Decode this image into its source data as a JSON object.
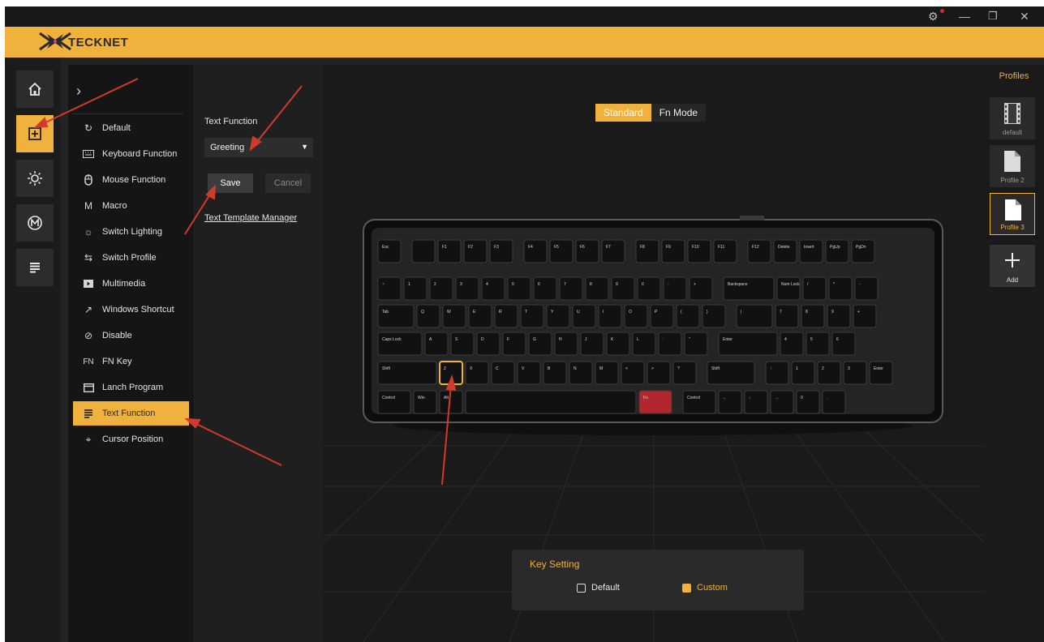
{
  "window": {
    "controls": [
      "settings-icon",
      "minimize-icon",
      "restore-icon",
      "close-icon"
    ]
  },
  "brand": {
    "name": "TECKNET",
    "accent": "#f0b23c"
  },
  "nav": {
    "items": [
      "home-icon",
      "key-assign-icon",
      "lighting-icon",
      "macro-icon",
      "list-icon"
    ],
    "active": 1
  },
  "function_panel": {
    "items": [
      {
        "icon": "reset-icon",
        "label": "Default"
      },
      {
        "icon": "keyboard-icon",
        "label": "Keyboard Function"
      },
      {
        "icon": "mouse-icon",
        "label": "Mouse Function"
      },
      {
        "icon": "macro-icon",
        "label": "Macro"
      },
      {
        "icon": "sun-icon",
        "label": "Switch Lighting"
      },
      {
        "icon": "switch-icon",
        "label": "Switch Profile"
      },
      {
        "icon": "play-icon",
        "label": "Multimedia"
      },
      {
        "icon": "arrow-icon",
        "label": "Windows Shortcut"
      },
      {
        "icon": "block-icon",
        "label": "Disable"
      },
      {
        "icon": "fn-icon",
        "label": "FN Key"
      },
      {
        "icon": "program-icon",
        "label": "Lanch Program"
      },
      {
        "icon": "text-icon",
        "label": "Text Function"
      },
      {
        "icon": "cursor-icon",
        "label": "Cursor Position"
      }
    ],
    "active_index": 11
  },
  "settings": {
    "title": "Text Function",
    "dropdown_value": "Greeting",
    "save": "Save",
    "cancel": "Cancel",
    "link": "Text Template Manager"
  },
  "modes": {
    "standard": "Standard",
    "fn": "Fn Mode",
    "active": "Standard"
  },
  "keyboard": {
    "rows": [
      [
        "Esc",
        "",
        "F1",
        "F2",
        "F3",
        "F4",
        "F5",
        "F6",
        "F7",
        "F8",
        "F9",
        "F10",
        "F11",
        "F12",
        "Delete",
        "Insert",
        "PgUp",
        "PgDn"
      ],
      [
        "~",
        "1",
        "2",
        "3",
        "4",
        "5",
        "6",
        "7",
        "8",
        "9",
        "0",
        "-",
        "+",
        "Backspace",
        "Num Lock",
        "/",
        "*",
        "-"
      ],
      [
        "Tab",
        "Q",
        "W",
        "E",
        "R",
        "T",
        "Y",
        "U",
        "I",
        "O",
        "P",
        "{",
        "}",
        "|",
        "7",
        "8",
        "9",
        "+"
      ],
      [
        "Caps Lock",
        "A",
        "S",
        "D",
        "F",
        "G",
        "H",
        "J",
        "K",
        "L",
        ":",
        "\"",
        "Enter",
        "4",
        "5",
        "6"
      ],
      [
        "Shift",
        "Z",
        "X",
        "C",
        "V",
        "B",
        "N",
        "M",
        "<",
        ">",
        "?",
        "Shift",
        "↑",
        "1",
        "2",
        "3",
        "Enter"
      ],
      [
        "Control",
        "Win",
        "Alt",
        "",
        "Fn",
        "Control",
        "←",
        "↓",
        "→",
        "0",
        "."
      ]
    ],
    "selected_key": "Z",
    "highlighted_key": "Fn",
    "highlight_color": "#b3262e"
  },
  "key_setting": {
    "title": "Key Setting",
    "default": "Default",
    "custom": "Custom",
    "selected": "Custom"
  },
  "profiles": {
    "title": "Profiles",
    "items": [
      "default",
      "Profile 2",
      "Profile 3"
    ],
    "selected_index": 2,
    "add": "Add"
  }
}
